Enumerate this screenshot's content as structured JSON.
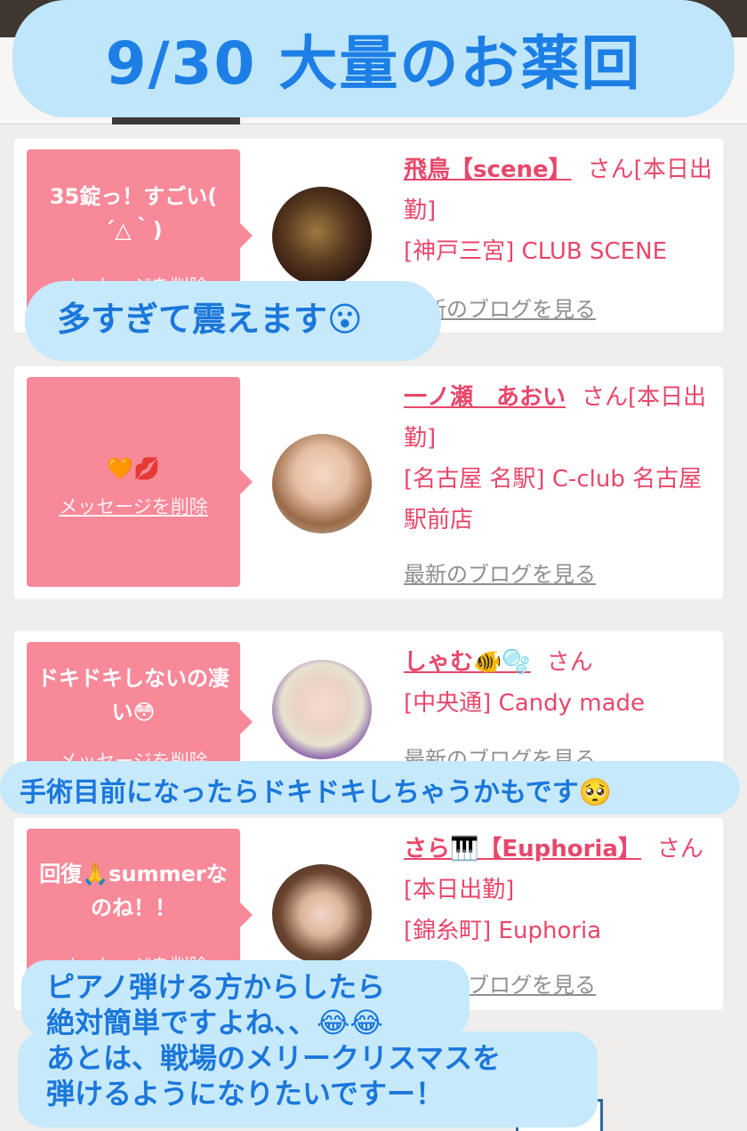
{
  "title": "9/30  大量のお薬回",
  "cards": [
    {
      "message": "35錠っ！すごい( ´△｀)",
      "delete_label": "メッセージを削除",
      "name": "飛鳥【scene】",
      "san": "さん[本日出勤]",
      "shop": "[神戸三宮] CLUB SCENE",
      "blog": "最新のブログを見る"
    },
    {
      "message": "🧡💋",
      "delete_label": "メッセージを削除",
      "name": "一ノ瀬　あおい",
      "san": "さん[本日出勤]",
      "shop": "[名古屋 名駅] C-club 名古屋駅前店",
      "blog": "最新のブログを見る"
    },
    {
      "message": "ドキドキしないの凄い😳",
      "delete_label": "メッセージを削除",
      "name": "しゃむ🐠🫧",
      "san": "さん",
      "shop": "[中央通] Candy made",
      "blog": "最新のブログを見る"
    },
    {
      "message": "回復🙏summerなのね！！",
      "delete_label": "メッセージを削除",
      "name": "さら🎹【Euphoria】",
      "san": "さん[本日出勤]",
      "shop": "[錦糸町] Euphoria",
      "blog": "最新のブログを見る"
    }
  ],
  "captions": {
    "c1": "多すぎて震えます😮",
    "c2": "手術目前になったらドキドキしちゃうかもです🥺",
    "c3": [
      "ピアノ弾ける方からしたら",
      "絶対簡単ですよね、、😂😂",
      "あとは、戦場のメリークリスマスを",
      "弾けるようになりたいですー！"
    ]
  },
  "colors": {
    "title_bg": "#bfe6fb",
    "title_text": "#1d7fe6",
    "message_bg": "#f78999",
    "name_text": "#e8476b"
  }
}
